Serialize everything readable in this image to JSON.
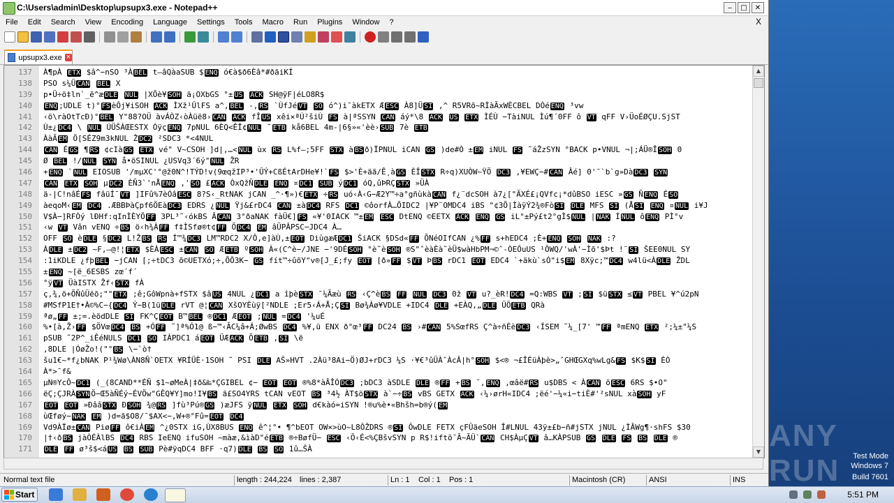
{
  "window": {
    "title": "C:\\Users\\admin\\Desktop\\upsupx3.exe - Notepad++",
    "close_x": "X"
  },
  "menu": [
    "File",
    "Edit",
    "Search",
    "View",
    "Encoding",
    "Language",
    "Settings",
    "Tools",
    "Macro",
    "Run",
    "Plugins",
    "Window",
    "?"
  ],
  "tab": {
    "label": "upsupx3.exe"
  },
  "lines": [
    {
      "n": "137",
      "t": "À¶pÀ ETX $â^−nSO ³ÀBEL t—âQàaSUB $ENQ ó€à$ð6Èâ*#ðãiKÍ"
    },
    {
      "n": "138",
      "t": "PSO s¼ÜCAN  BEL X"
    },
    {
      "n": "139",
      "t": "p•Ü÷ö‡ln`_ë^æDLE NUL |XÕè¥SOH ä¡OXbGS °±US ACK SH@ÿF|éLO8R$"
    },
    {
      "n": "140",
      "t": "ENQ;UDLE t)°FSèÔj¥iSOH ACK ÌXž¹ÛlFS a^,BEL -,RS `ÙfJéVT SO ó^)iˆàkETX ÆESC À8]ÜSI ,^ R5VRõ~RÌàÃxWÈCBEL DÒéENQ ³vw"
    },
    {
      "n": "141",
      "t": "‹ö\\ràOtTcÐ)°BEL Y\"88?OÜ àvÁÒZ‹òÀüë8›CAN ACK fÎUS xêi×ªÚ²šiÙ FS à|ªSSYN CAN áý*\\8 ACK US ETX ÌÉÙ −TàiNUL Ìú¶´0FF ô VT qFF V›ÜoÉØÇU.SjST"
    },
    {
      "n": "142",
      "t": "Ú±¿DC4 \\ NUL ÚÜŠÀŒESTX ÓÿçENQ 7pNUL 6ÈQ<ÊÎ¢NUL ˜ETB kå6BEL 4m-|6§»«'èè›SUB 7è ETB"
    },
    {
      "n": "143",
      "t": "ÀàÃEM Ö[SÉZ9m3kNUL ŽDC2 ²SDC3 *<4NUL"
    },
    {
      "n": "144",
      "t": "CAN ÉGS ¶RS ¢cIàGS ETX vé\" V~CSOH ]d|,…<NUL ùx RS L%f—;5FF STX àBSð)ÏPNUL iCAN GS )de#Ò ±EM iNUL FS ˜áŽzSYN °BACK p•VNUL ¬|;ÁÜ®ÎSOH 0"
    },
    {
      "n": "145",
      "t": "Ø BEL !/NUL SYN å•öSINUL ¿USVq3´6ý\"NUL ŽR"
    },
    {
      "n": "146",
      "t": "+ENQ `NUL EIOSUB '/mµXC'°@ž0N^!TÝD!v(9œqžIP³•'ÛÝ+CßÉtArDHe¥!`FS $>'È+äã/Ê¸àGS ÈÎSTX R÷q)XUÒW~ŸÖ DC3 ,¥EWÇ−#CAN Âé] 0'¯`b`g»DàDC3 SYN"
    },
    {
      "n": "147",
      "t": "CAN ETX SOH µDC2 ÈÑ3`'nÅENQ ,'SO £ACK ÒxQžÑDLE ENQ ¤DC1 SUB ýDC1 óQ,ûÞRÇSTX »ÜÀ"
    },
    {
      "n": "148",
      "t": "ä-|C!nâÉFS fâüÍ¯VT ]IFû%7èÓâESC 8?S‹_RtNAK jCAN _^·¶»)€ETX ÷RS uó‹À‹G−Æ2Y™÷a°gñùkàCAN f¿¨dcSOH à7¿[\"ÃXÉ£¡QVfc¡*dûBSO iESC »GS ÑENQ ÉSO"
    },
    {
      "n": "149",
      "t": "àeqoM‹EM DC4 .ÆBBÞàÇpf6ÖEàDC3 EDRS ¿NUL Ÿj&£rDC4 CAN ±àDC4 RFS DC1 ©ôorfÀ…ÕIDC2 |¥P¨OMDC4 iBS \"¢3Õ|ÌàÿÝ2¾®FòSI DLE MFS SI (ÅSI ENQ ¤NUL i¥J"
    },
    {
      "n": "150",
      "t": "V$À−]RFÒý lÐHf:qInÌÈYÖFF 3PL³˜‹ókBS ÂCAN 3°ðaNAK fàÜ€]FS «¥'0IACK ™±EM ESC DtENQ ©EETX ACK ENQ GS iL°±Pý£t2°gÌ$NUL |NAK ÍNUL ôENQ PÌ°v"
    },
    {
      "n": "151",
      "t": "‹w VT Vân vENQ ÷BS ö‹h¾ÀFF f‡ÌSfø®t¢FF ÖDC4 EM âÜPÂPSC−JDC4 À…"
    },
    {
      "n": "152",
      "t": "OFF SO èDLE §DC2 L!ŽBS RS Í™¾DC3 LM™RDC2 X/Ô,e]àÙ,±EOT DiùgæÆDC1 ŠiACK §DSd«FF ÕNéOIfCAN ¿%FF s+hEDC4 ;È+ENQ SOH NAK :?"
    },
    {
      "n": "153",
      "t": "ÀDLE ±DC2 ~F,—@!¦ETX $ÈÀESC ±CAN SO ÆETB ºSOH À«(C^è−/JNE −'9DÉSOH °è˜èSOH ®S\"ˆèàÈà˜èÜ$wàHbPM¬©ˆ-ÒEÔuUS ¹ÔWQ/'wÀ'−Ìõ'$Þt !¨SI ŠEE0NUL SY"
    },
    {
      "n": "154",
      "t": ":1iKDLE ¿fþBEL −jCAN [;÷tDC3 õ©UETXó;÷,ÕÔ3K− GS fít™÷ûõY\"v®[J_£;fy EOT [ð»FF $VT ÞBS rDC1 EOT EDC4 `+äkù`sÓ\"i$EM 8Xÿc;™DC4 w4lü<ÀDLE ŽDL"
    },
    {
      "n": "155",
      "t": "±ENQ ~[ë_6ESBS zœ´f´"
    },
    {
      "n": "156",
      "t": "°ÿVT ÜàISTX Žf‹STX fÀ"
    },
    {
      "n": "157",
      "t": "ç,¾,ö+ÕÑûÜëõ;\"\"ETX ;ê;GôWpnà+fSTX $âUS 4NUL ¿DC1 a îþèSTX ¯¼Ãæù RS ‹Ç^èBS FF NUL DC3 0ž VT u?_èR!DC4 =Q:WBS VT ;SI $üSTX ≤VT PBEL ¥^ú2pN"
    },
    {
      "n": "158",
      "t": "#MSfP1E†•À©%C−{DC4 Ý−B(1üDLE rVT @¦CAN XšOYÈùÿ[²NDLE ;Er5‹Á+Å;ÇSI Bø¾Àø¥VDLE +IDC4 DLE +EÀQ,„DLE ÜÖETB QRà"
    },
    {
      "n": "159",
      "t": "ªø„FF ±;=.èödDLE SI FK^ÇEOT B™BEL ®DC1 ÆEOT ;NUL =DC4 '¼uÉ"
    },
    {
      "n": "160",
      "t": "%•[à,Ž›FF $ÖVœDC4 BS +ÓFF ˜]ª%Ó1@ ß−™‹ÃC¼â+Á;ØwBS DC4 %¥,ü ENX ð°œ³FF DC24 BS ›#CAN 5%SœfRS Ç^à÷ñÉèDC3 ‹ÍSEM ˜¼_[7' ™FF ªmENQ ETX ²;¼±\"¼S"
    },
    {
      "n": "161",
      "t": "pSUB ˜2P^_iÊéNULS DC1 SO IÀPDC1 áEOT ÜÆACK ÕETB ,SI \\ë"
    },
    {
      "n": "162",
      "t": ",8DLE |ÓøŽo!(\"°BS \\−`ò†"
    },
    {
      "n": "163",
      "t": "šu1€~*f¿bNAK P¹¾Wø\\ÀN8Ñ`OETX ¥RÍÜÈ·1SOH ˜ PSI DLE AŠ»HVT .2Àü³8Ai−Ö)ØJ+rDC3 ¼S ·¥€³ûÜÀˆÀcÂ|h°SOH $<® ¬£ÎÉüÀþè>„ˆGHŒGXq%wLg&FS $K$SI ÈÒ"
    },
    {
      "n": "164",
      "t": "À*>¯f&"
    },
    {
      "n": "165",
      "t": "µN®YcÔ~DC1 (_(8CAND**ÉÑ $1~øMeÀ|‡ð&‰*ÇGIBEL ¢− EOT EOT ®%8*àÂÎÓDC3 ;bDC3 àSDLE DLE ®FF +BS ¯,ENQ ,œâë#RS u$DBS < ÀCAN õESC 6RS $•O\""
    },
    {
      "n": "166",
      "t": "ëÇ;ÇJRÀSYNÖ−Œ5àÑÉý−ÉVÖw\"GÊQ¥Y]mo!I¥BS ã£SO4YRS tCAN vEOT BS ³4½ ÀT$öSTX à`−÷BS vBS GETX ACK ‹¼›ørH«IDC4 ;ëé'−¼«i−tiÈ#'²sNUL xàSOH yF"
    },
    {
      "n": "167",
      "t": "EOT EOT »ÐââSTX ÐSOH ¾@RS ]fù³Pú®GS )æJFS ÿNUL ETX SOH d€kàó=iSYN !®u%è•«Bhšh=b®ý(EM"
    },
    {
      "n": "168",
      "t": "ùŒføý−NAK EM )d=ã$O8/¯$AX<−,W+®°Fû=EOT DC4"
    },
    {
      "n": "169",
      "t": "Vd9ÀÏø±CAN PiøFF ô€iÀEM ^¿0STX iG,ÙX8BUS ENQ ê^¦°• ¶^bEOT OW×>ùO~L8ÔŽDRS ®SI ÔwDLE FETX çFÛäeSOH Î#LNUL 43ÿ±£b−ñ#jSTX jNUL ¿ÌÂWg¶·shFS $30"
    },
    {
      "n": "170",
      "t": "|†‹ðBS jàÒÉÀlBS DC4 RBS IeENQ ifuSOH ~màæ,&ìàD\"éETB ®÷BøfÜ− ESC ‹Ö‹É<%ÇBšvSYN p R$!iftõ¯Ã~ÃÜ`CAN CH$ÀµÇVT â…KÀPSUB GS DLE FS BS DLE ®"
    },
    {
      "n": "171",
      "t": "DLE FF ø³š$<áUS BS SUB Pè#ÿqDC4 BFF ·q7)DLE BS SO 1û…ŠÀ"
    }
  ],
  "status": {
    "type": "Normal text file",
    "length": "length : 244,224",
    "lines": "lines : 2,387",
    "ln": "Ln : 1",
    "col": "Col : 1",
    "pos": "Pos : 1",
    "eol": "Macintosh (CR)",
    "encoding": "ANSI",
    "ins": "INS"
  },
  "desktop": {
    "watermark": "ANY RUN",
    "mode": "Test Mode",
    "os": "Windows 7",
    "build": "Build 7601"
  },
  "taskbar": {
    "start": "Start",
    "time": "5:51 PM"
  }
}
